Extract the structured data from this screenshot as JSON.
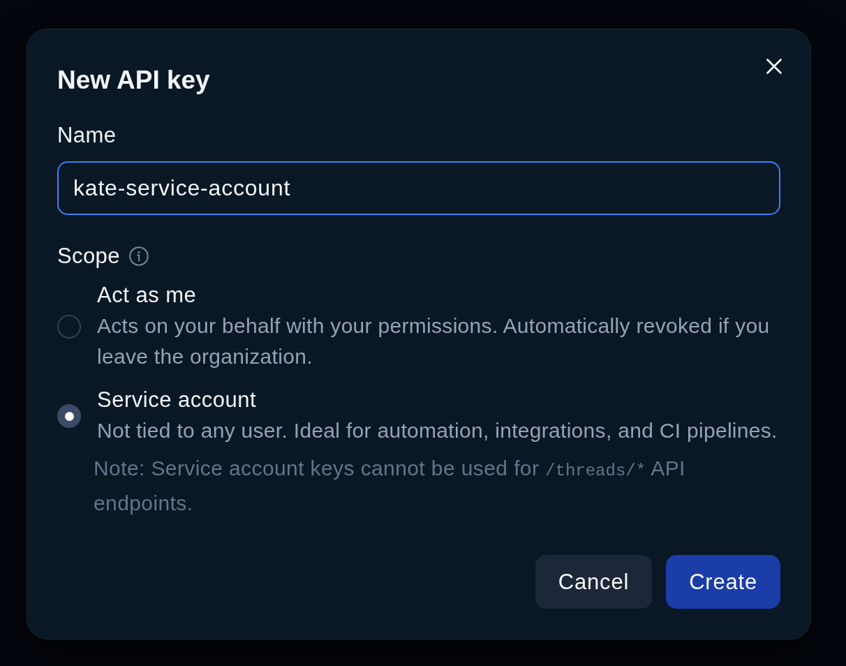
{
  "dialog": {
    "title": "New API key"
  },
  "name_field": {
    "label": "Name",
    "value": "kate-service-account",
    "focused": true
  },
  "scope": {
    "label": "Scope",
    "options": [
      {
        "title": "Act as me",
        "description": "Acts on your behalf with your permissions. Automatically revoked if you leave the organization.",
        "selected": false
      },
      {
        "title": "Service account",
        "description": "Not tied to any user. Ideal for automation, integrations, and CI pipelines.",
        "selected": true
      }
    ],
    "note": {
      "text_before": "Note: Service account keys cannot be used for",
      "code": "/threads/*",
      "text_after": "API endpoints."
    }
  },
  "buttons": [
    {
      "label": "Cancel",
      "kind": "secondary"
    },
    {
      "label": "Create",
      "kind": "primary"
    }
  ]
}
